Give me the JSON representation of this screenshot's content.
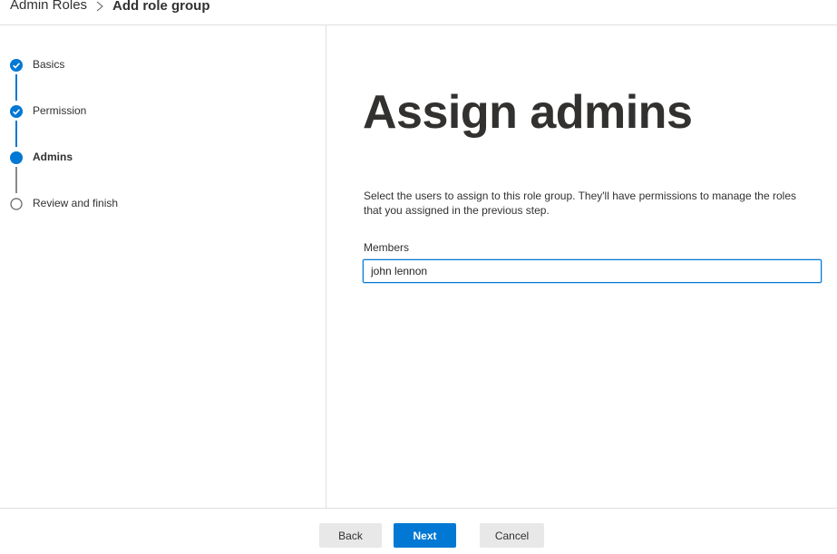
{
  "breadcrumb": {
    "parent": "Admin Roles",
    "current": "Add role group"
  },
  "steps": [
    {
      "label": "Basics",
      "state": "completed"
    },
    {
      "label": "Permission",
      "state": "completed"
    },
    {
      "label": "Admins",
      "state": "current"
    },
    {
      "label": "Review and finish",
      "state": "pending"
    }
  ],
  "main": {
    "title": "Assign admins",
    "description": "Select the users to assign to this role group. They'll have permissions to manage the roles that you assigned in the previous step.",
    "members_label": "Members",
    "members_value": "john lennon"
  },
  "footer": {
    "back_label": "Back",
    "next_label": "Next",
    "cancel_label": "Cancel"
  },
  "colors": {
    "accent": "#0078d4",
    "text": "#323130",
    "pending_step": "#8a8886",
    "secondary_button": "#e8e8e8"
  },
  "icons": {
    "completed_step": "checkmark-circle-icon",
    "current_step": "filled-circle-icon",
    "pending_step": "empty-circle-icon",
    "breadcrumb_separator": "chevron-right-icon"
  }
}
